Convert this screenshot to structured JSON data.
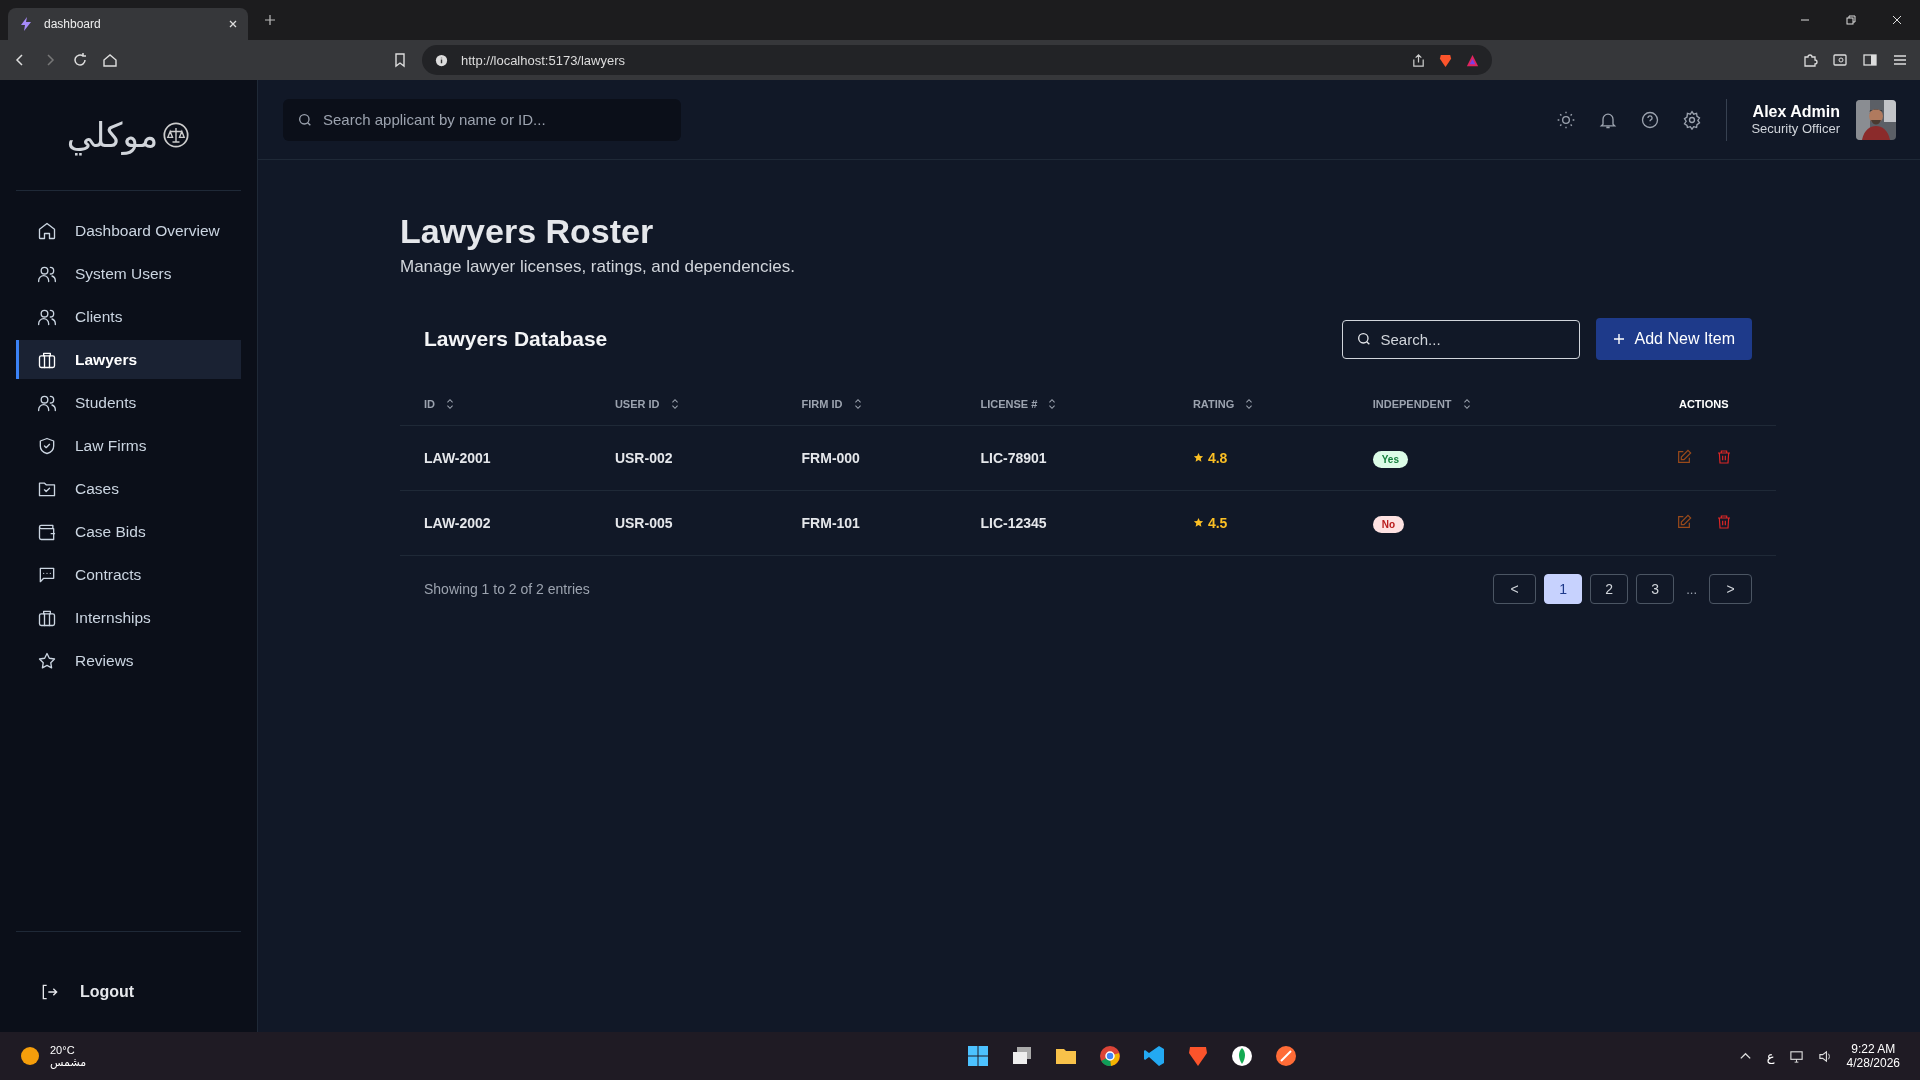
{
  "browser": {
    "tab_title": "dashboard",
    "url": "http://localhost:5173/lawyers"
  },
  "logo": {
    "text": "موكلي"
  },
  "sidebar": {
    "items": [
      {
        "label": "Dashboard Overview",
        "selected": false
      },
      {
        "label": "System Users",
        "selected": false
      },
      {
        "label": "Clients",
        "selected": false
      },
      {
        "label": "Lawyers",
        "selected": true
      },
      {
        "label": "Students",
        "selected": false
      },
      {
        "label": "Law Firms",
        "selected": false
      },
      {
        "label": "Cases",
        "selected": false
      },
      {
        "label": "Case Bids",
        "selected": false
      },
      {
        "label": "Contracts",
        "selected": false
      },
      {
        "label": "Internships",
        "selected": false
      },
      {
        "label": "Reviews",
        "selected": false
      }
    ],
    "logout": "Logout"
  },
  "header": {
    "search_placeholder": "Search applicant by name or ID...",
    "user_name": "Alex Admin",
    "user_role": "Security Officer"
  },
  "page": {
    "title": "Lawyers Roster",
    "subtitle": "Manage lawyer licenses, ratings, and dependencies."
  },
  "table": {
    "title": "Lawyers Database",
    "search_placeholder": "Search...",
    "add_button": "Add New Item",
    "columns": [
      {
        "label": "ID",
        "sortable": true
      },
      {
        "label": "USER ID",
        "sortable": true
      },
      {
        "label": "FIRM ID",
        "sortable": true
      },
      {
        "label": "LICENSE #",
        "sortable": true
      },
      {
        "label": "RATING",
        "sortable": true
      },
      {
        "label": "INDEPENDENT",
        "sortable": true
      },
      {
        "label": "ACTIONS",
        "sortable": false
      }
    ],
    "rows": [
      {
        "id": "LAW-2001",
        "user_id": "USR-002",
        "firm_id": "FRM-000",
        "license": "LIC-78901",
        "rating": "4.8",
        "independent": true,
        "independent_label": "Yes"
      },
      {
        "id": "LAW-2002",
        "user_id": "USR-005",
        "firm_id": "FRM-101",
        "license": "LIC-12345",
        "rating": "4.5",
        "independent": false,
        "independent_label": "No"
      }
    ],
    "footer": "Showing 1 to 2 of 2 entries",
    "pagination": {
      "prev": "<",
      "pages": [
        {
          "label": "1",
          "selected": true
        },
        {
          "label": "2",
          "selected": false
        },
        {
          "label": "3",
          "selected": false
        }
      ],
      "ellipsis": "...",
      "next": ">"
    }
  },
  "taskbar": {
    "temperature": "20°C",
    "weather": "مشمس",
    "input_language": "ع",
    "time": "9:22 AM",
    "date": "4/28/2026"
  }
}
